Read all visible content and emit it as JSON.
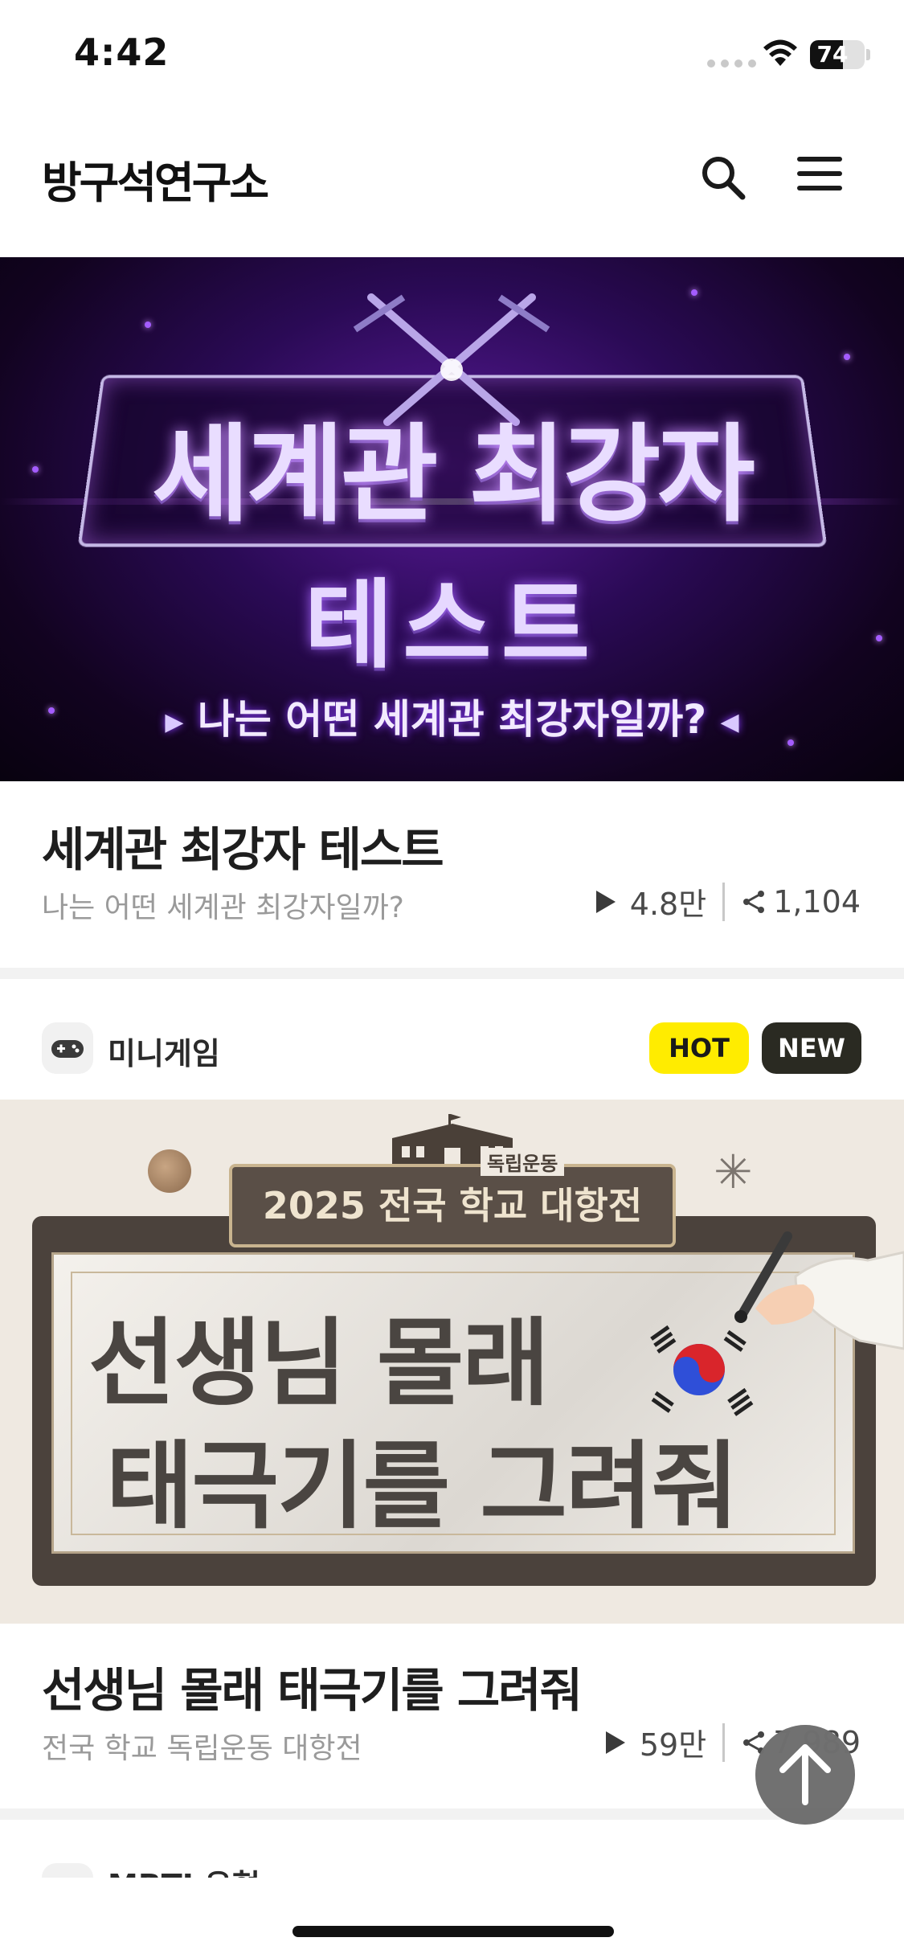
{
  "status_bar": {
    "time": "4:42",
    "battery": "74",
    "battery_level_percent": 74
  },
  "header": {
    "logo": "방구석연구소",
    "search_icon": "search-icon",
    "menu_icon": "hamburger-menu-icon"
  },
  "feed": [
    {
      "banner": {
        "title_line1": "세계관 최강자",
        "title_line2": "테스트",
        "tagline": "나는 어떤 세계관 최강자일까?",
        "accent_color": "#2a0a55"
      },
      "title": "세계관 최강자 테스트",
      "subtitle": "나는 어떤 세계관 최강자일까?",
      "plays": "4.8만",
      "shares": "1,104"
    },
    {
      "category": {
        "label": "미니게임",
        "icon": "gamepad-icon"
      },
      "badges": {
        "hot": "HOT",
        "new": "NEW",
        "hot_color": "#ffec00",
        "new_color": "#2a2a22"
      },
      "banner": {
        "ribbon": "2025 전국 학교 대항전",
        "ribbon_tag": "독립운동",
        "line1": "선생님 몰래",
        "line2": "태극기를 그려줘"
      },
      "title": "선생님 몰래 태극기를 그려줘",
      "subtitle": "전국 학교 독립운동 대항전",
      "plays": "59만",
      "shares": "7,989"
    },
    {
      "category": {
        "label": "MBTI 유형",
        "icon": "category-icon"
      }
    }
  ],
  "scroll_top_icon": "arrow-up-icon"
}
